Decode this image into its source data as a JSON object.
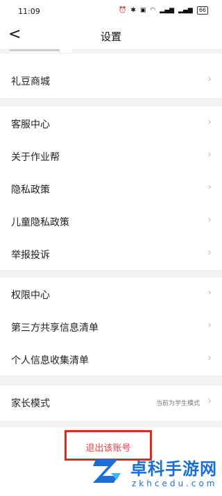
{
  "status": {
    "time": "11:09",
    "battery": "66"
  },
  "header": {
    "title": "设置",
    "back_icon": "chevron-left-icon"
  },
  "groups": [
    {
      "items": [
        {
          "label": "礼豆商城"
        }
      ]
    },
    {
      "items": [
        {
          "label": "客服中心"
        },
        {
          "label": "关于作业帮"
        },
        {
          "label": "隐私政策"
        },
        {
          "label": "儿童隐私政策"
        },
        {
          "label": "举报投诉"
        }
      ]
    },
    {
      "items": [
        {
          "label": "权限中心"
        },
        {
          "label": "第三方共享信息清单"
        },
        {
          "label": "个人信息收集清单"
        }
      ]
    },
    {
      "items": [
        {
          "label": "家长模式",
          "value": "当前为学生模式"
        }
      ]
    }
  ],
  "logout": {
    "label": "退出该账号"
  },
  "watermark": {
    "cn": "卓科手游网",
    "en": "zkhcedu.com"
  },
  "colors": {
    "accent_red": "#e64340",
    "watermark_blue": "#1a6fd6"
  }
}
